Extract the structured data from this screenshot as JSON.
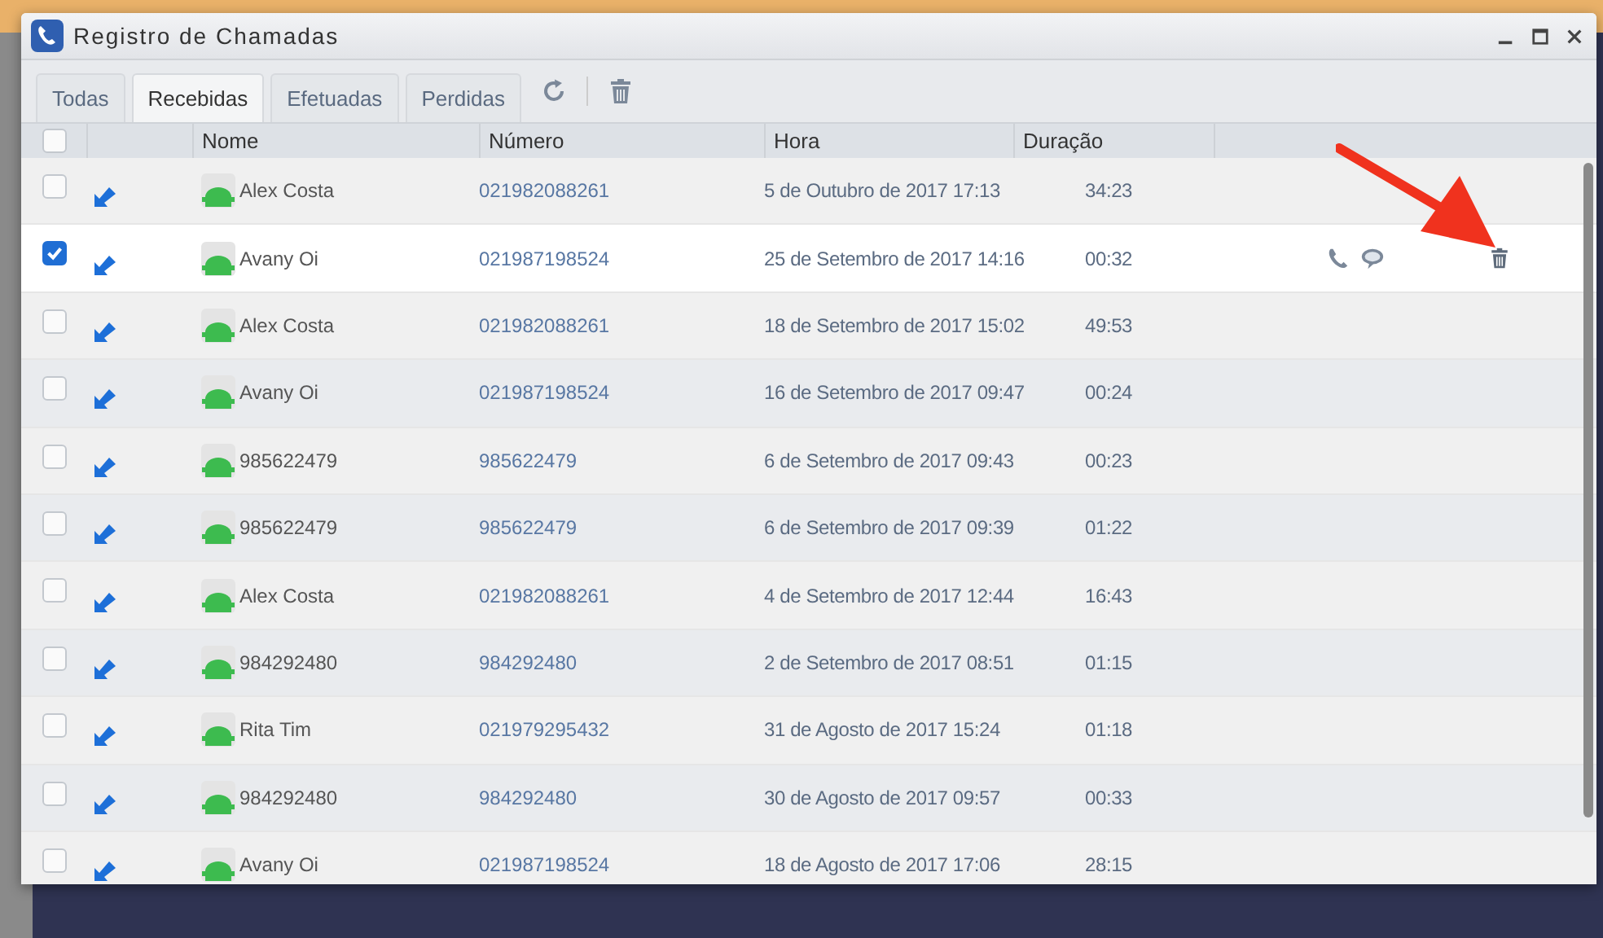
{
  "window": {
    "title": "Registro de Chamadas"
  },
  "tabs": [
    {
      "label": "Todas",
      "selected": false
    },
    {
      "label": "Recebidas",
      "selected": true
    },
    {
      "label": "Efetuadas",
      "selected": false
    },
    {
      "label": "Perdidas",
      "selected": false
    }
  ],
  "table": {
    "columns": [
      "Nome",
      "Número",
      "Hora",
      "Duração"
    ],
    "all_checked": false,
    "rows": [
      {
        "name": "Alex Costa",
        "number": "021982088261",
        "time": "5 de Outubro de 2017 17:13",
        "duration": "34:23",
        "checked": false,
        "selected": false,
        "hovered": false
      },
      {
        "name": "Avany Oi",
        "number": "021987198524",
        "time": "25 de Setembro de 2017 14:16",
        "duration": "00:32",
        "checked": true,
        "selected": true,
        "hovered": true
      },
      {
        "name": "Alex Costa",
        "number": "021982088261",
        "time": "18 de Setembro de 2017 15:02",
        "duration": "49:53",
        "checked": false,
        "selected": false,
        "hovered": false
      },
      {
        "name": "Avany Oi",
        "number": "021987198524",
        "time": "16 de Setembro de 2017 09:47",
        "duration": "00:24",
        "checked": false,
        "selected": false,
        "hovered": false
      },
      {
        "name": "985622479",
        "number": "985622479",
        "time": "6 de Setembro de 2017 09:43",
        "duration": "00:23",
        "checked": false,
        "selected": false,
        "hovered": false
      },
      {
        "name": "985622479",
        "number": "985622479",
        "time": "6 de Setembro de 2017 09:39",
        "duration": "01:22",
        "checked": false,
        "selected": false,
        "hovered": false
      },
      {
        "name": "Alex Costa",
        "number": "021982088261",
        "time": "4 de Setembro de 2017 12:44",
        "duration": "16:43",
        "checked": false,
        "selected": false,
        "hovered": false
      },
      {
        "name": "984292480",
        "number": "984292480",
        "time": "2 de Setembro de 2017 08:51",
        "duration": "01:15",
        "checked": false,
        "selected": false,
        "hovered": false
      },
      {
        "name": "Rita Tim",
        "number": "021979295432",
        "time": "31 de Agosto de 2017 15:24",
        "duration": "01:18",
        "checked": false,
        "selected": false,
        "hovered": false
      },
      {
        "name": "984292480",
        "number": "984292480",
        "time": "30 de Agosto de 2017 09:57",
        "duration": "00:33",
        "checked": false,
        "selected": false,
        "hovered": false
      },
      {
        "name": "Avany Oi",
        "number": "021987198524",
        "time": "18 de Agosto de 2017 17:06",
        "duration": "28:15",
        "checked": false,
        "selected": false,
        "hovered": false
      }
    ]
  }
}
